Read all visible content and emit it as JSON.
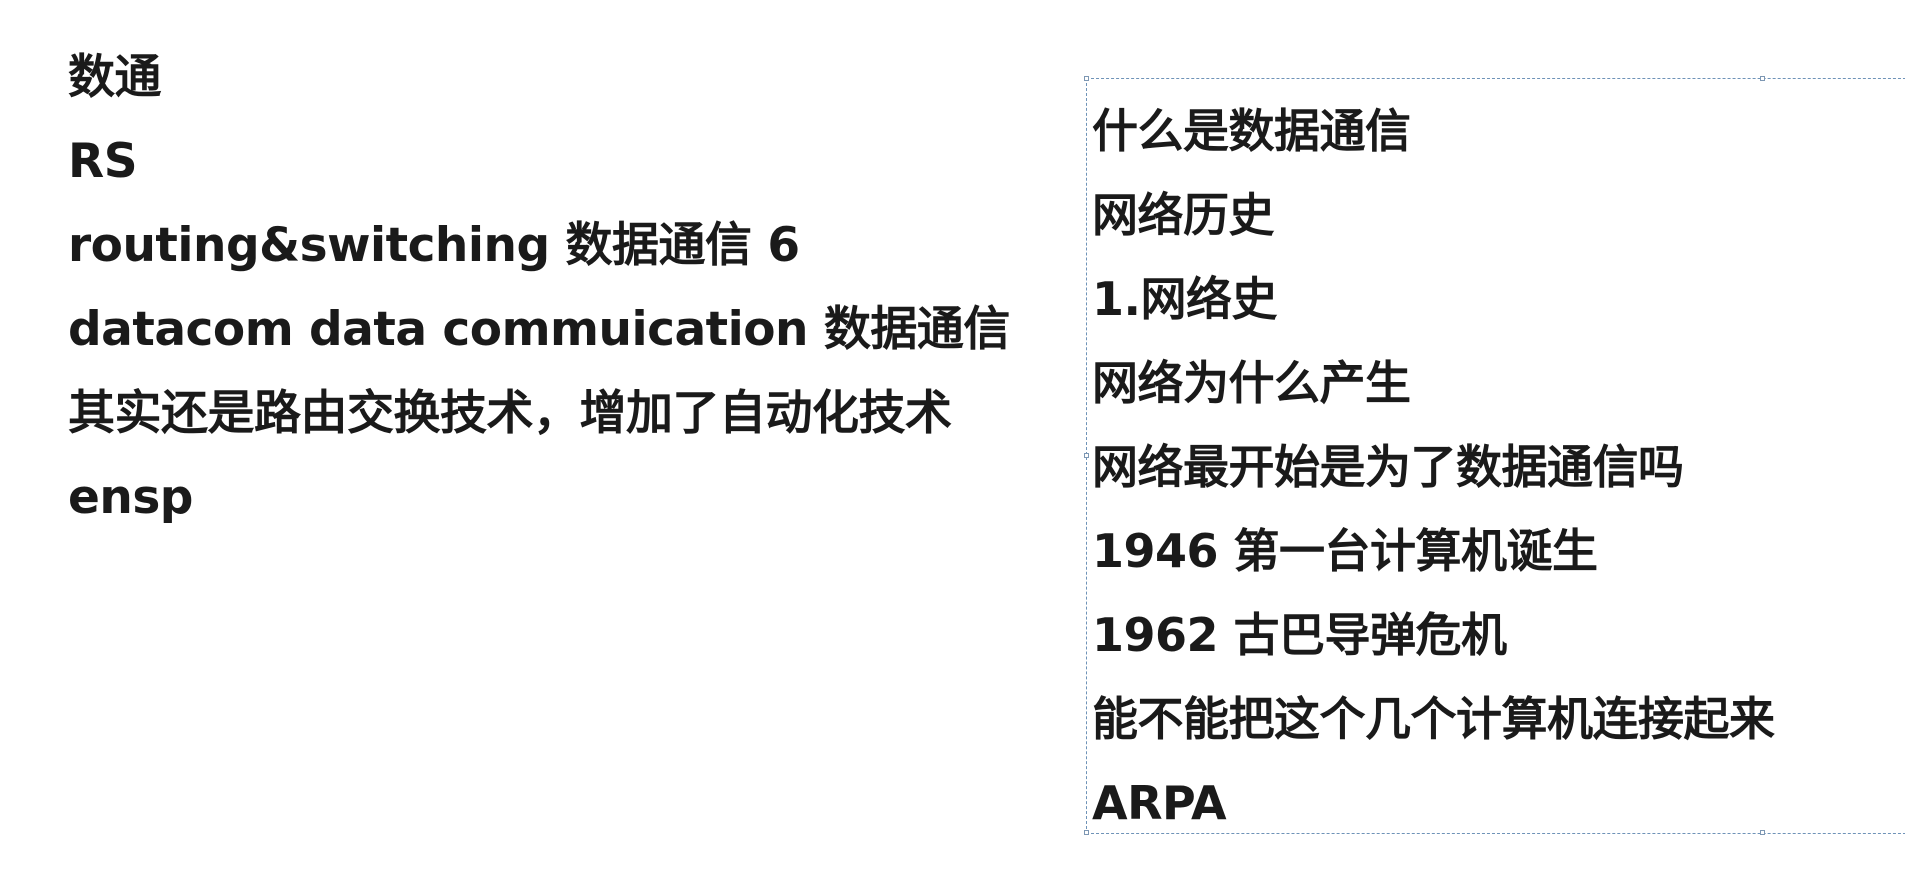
{
  "left_notes": [
    "数通",
    "RS",
    "routing&switching 数据通信 6",
    "datacom data commuication 数据通信",
    "其实还是路由交换技术，增加了自动化技术",
    "ensp"
  ],
  "text_box": {
    "lines": [
      "什么是数据通信",
      "网络历史",
      "1.网络史",
      "网络为什么产生",
      "网络最开始是为了数据通信吗",
      "1946 第一台计算机诞生",
      "1962  古巴导弹危机",
      "能不能把这个几个计算机连接起来",
      "ARPA"
    ],
    "border_color": "#6f93b8"
  }
}
